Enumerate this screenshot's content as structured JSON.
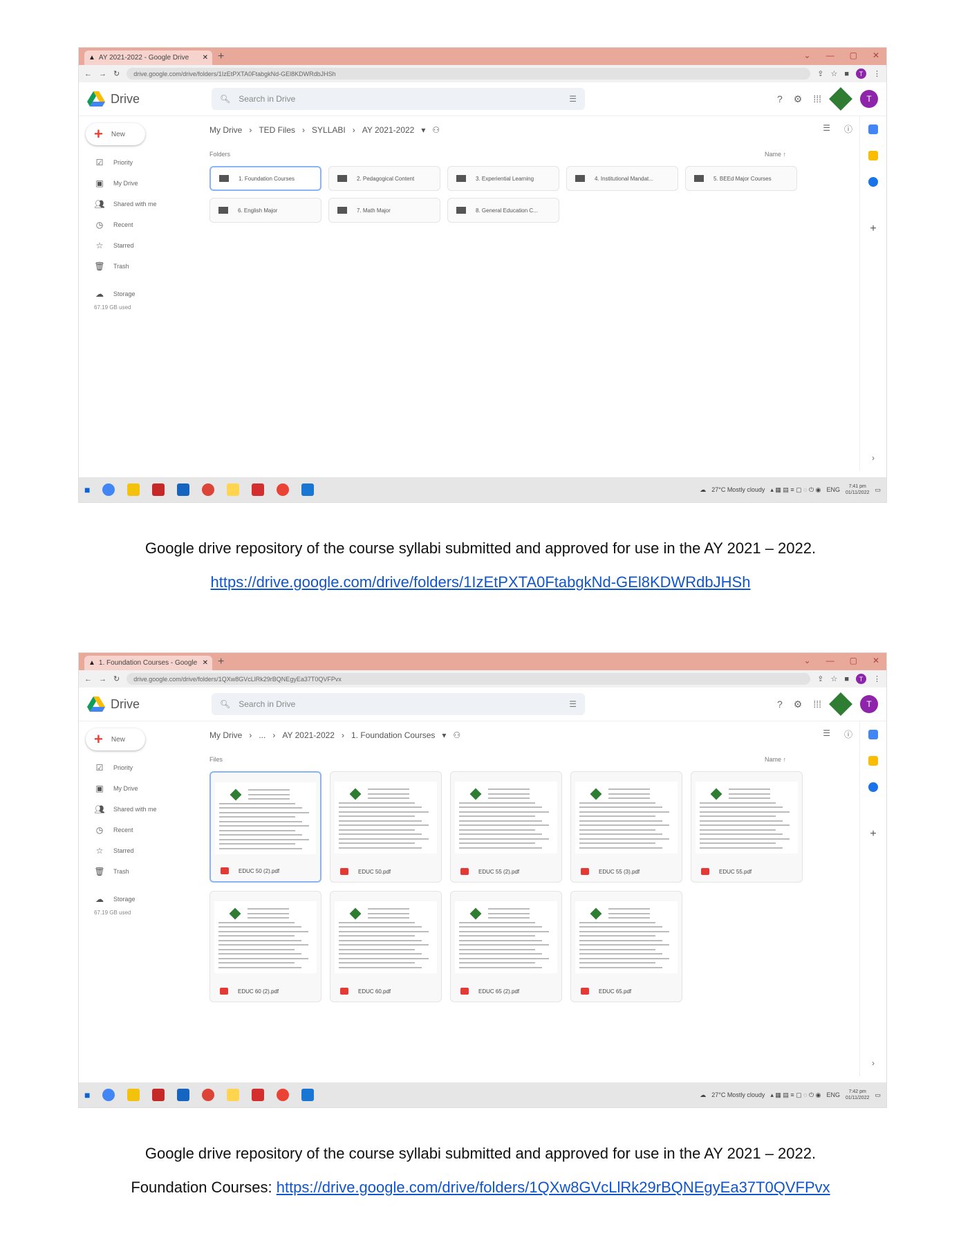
{
  "screenshots": [
    {
      "tab_title": "AY 2021-2022 - Google Drive",
      "url": "drive.google.com/drive/folders/1IzEtPXTA0FtabgkNd-GEl8KDWRdbJHSh",
      "app_name": "Drive",
      "search_placeholder": "Search in Drive",
      "avatar_letter": "T",
      "breadcrumb": [
        "My Drive",
        "TED Files",
        "SYLLABI",
        "AY 2021-2022"
      ],
      "section_label": "Folders",
      "sort_label": "Name",
      "folders": [
        "1. Foundation Courses",
        "2. Pedagogical Content",
        "3. Experiential Learning",
        "4. Institutional Mandat...",
        "5. BEEd Major Courses",
        "6. English Major",
        "7. Math Major",
        "8. General Education C..."
      ],
      "weather": "27°C Mostly cloudy",
      "lang": "ENG",
      "time": "7:41 pm",
      "date": "01/11/2022"
    },
    {
      "tab_title": "1. Foundation Courses - Google",
      "url": "drive.google.com/drive/folders/1QXw8GVcLlRk29rBQNEgyEa37T0QVFPvx",
      "app_name": "Drive",
      "search_placeholder": "Search in Drive",
      "avatar_letter": "T",
      "breadcrumb": [
        "My Drive",
        "...",
        "AY 2021-2022",
        "1. Foundation Courses"
      ],
      "section_label": "Files",
      "sort_label": "Name",
      "files": [
        "EDUC 50 (2).pdf",
        "EDUC 50.pdf",
        "EDUC 55 (2).pdf",
        "EDUC 55 (3).pdf",
        "EDUC 55.pdf",
        "EDUC 60 (2).pdf",
        "EDUC 60.pdf",
        "EDUC 65 (2).pdf",
        "EDUC 65.pdf"
      ],
      "weather": "27°C Mostly cloudy",
      "lang": "ENG",
      "time": "7:42 pm",
      "date": "01/11/2022"
    }
  ],
  "sidebar": {
    "new_label": "New",
    "items": [
      "Priority",
      "My Drive",
      "Shared with me",
      "Recent",
      "Starred",
      "Trash"
    ],
    "storage_label": "Storage",
    "storage_used": "67.19 GB used"
  },
  "captions": {
    "caption1": "Google drive repository of the course syllabi submitted and approved for use in the AY 2021 – 2022.",
    "link1": "https://drive.google.com/drive/folders/1IzEtPXTA0FtabgkNd-GEl8KDWRdbJHSh",
    "caption2": "Google drive repository of the course syllabi submitted and approved for use in the AY 2021 – 2022.",
    "link2_prefix": "Foundation Courses:",
    "link2": "https://drive.google.com/drive/folders/1QXw8GVcLlRk29rBQNEgyEa37T0QVFPvx"
  },
  "colors": {
    "tabbar": "#e8a89a",
    "accent": "#8ab4f8",
    "link": "#1155cc"
  }
}
